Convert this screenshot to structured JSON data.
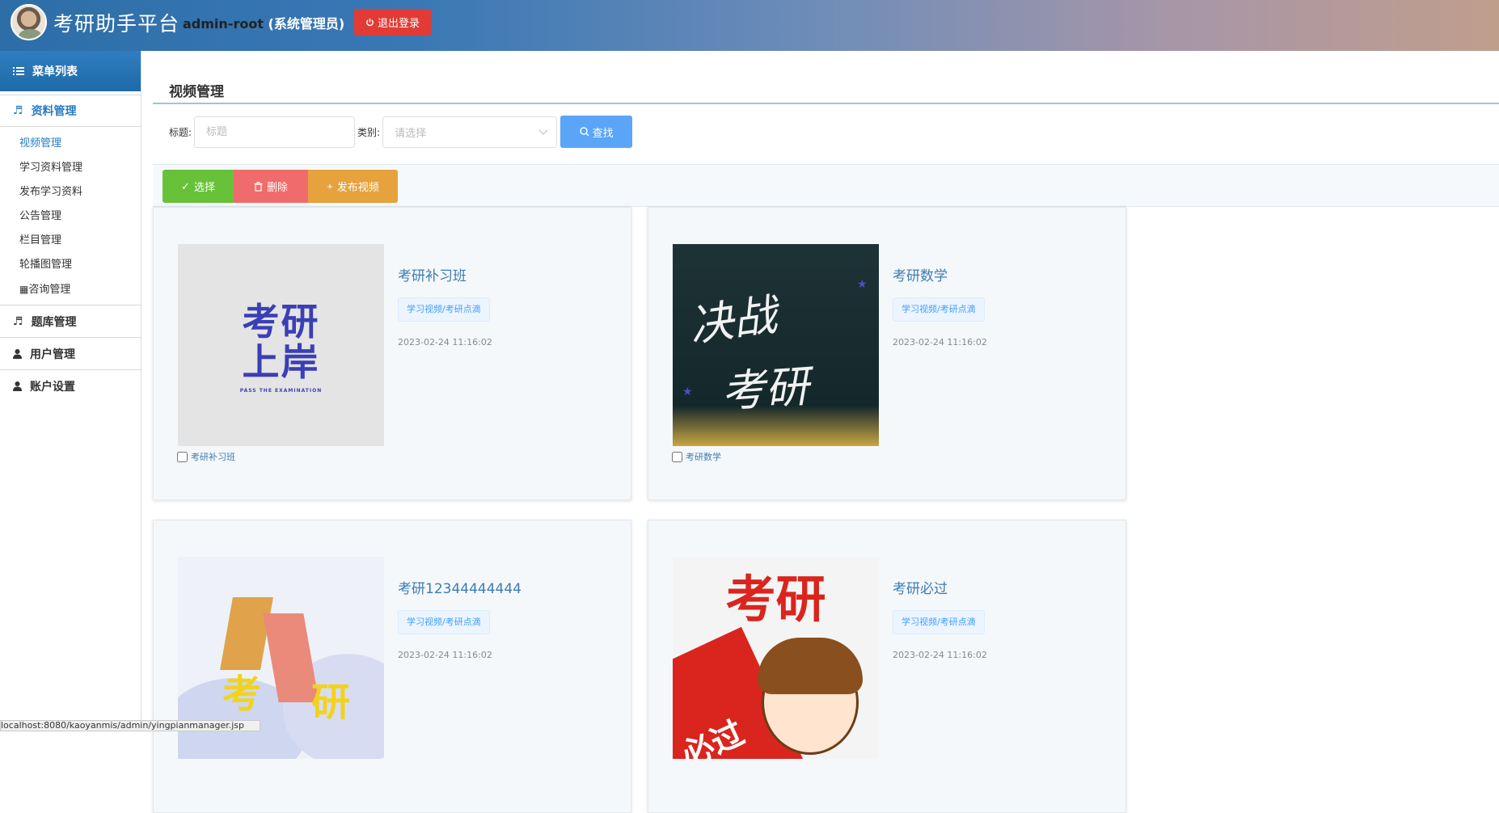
{
  "header": {
    "site_title": "考研助手平台",
    "username": "admin-root",
    "role": "(系统管理员)",
    "logout_label": "退出登录"
  },
  "sidebar": {
    "menu_title": "菜单列表",
    "sections": [
      {
        "label": "资料管理",
        "icon": "music-note-icon",
        "active": true
      },
      {
        "label": "题库管理",
        "icon": "music-note-icon"
      },
      {
        "label": "用户管理",
        "icon": "user-icon"
      },
      {
        "label": "账户设置",
        "icon": "user-icon"
      }
    ],
    "sub_items": [
      {
        "label": "视频管理",
        "active": true
      },
      {
        "label": "学习资料管理"
      },
      {
        "label": "发布学习资料"
      },
      {
        "label": "公告管理"
      },
      {
        "label": "栏目管理"
      },
      {
        "label": "轮播图管理"
      },
      {
        "label": "咨询管理",
        "icon": "calendar-icon"
      }
    ]
  },
  "main": {
    "page_title": "视频管理",
    "search": {
      "title_label": "标题:",
      "title_placeholder": "标题",
      "category_label": "类别:",
      "category_placeholder": "请选择",
      "search_button": "查找"
    },
    "toolbar": {
      "select_label": "选择",
      "delete_label": "删除",
      "publish_label": "发布视频"
    },
    "cards": [
      {
        "title": "考研补习班",
        "tag": "学习视频/考研点滴",
        "date": "2023-02-24 11:16:02",
        "checkbox_label": "考研补习班",
        "thumb_text_1": "考研",
        "thumb_text_2": "上岸",
        "thumb_subtext": "PASS THE EXAMINATION"
      },
      {
        "title": "考研数学",
        "tag": "学习视频/考研点滴",
        "date": "2023-02-24 11:16:02",
        "checkbox_label": "考研数学",
        "thumb_text_1": "决战",
        "thumb_text_2": "考研"
      },
      {
        "title": "考研12344444444",
        "tag": "学习视频/考研点滴",
        "date": "2023-02-24 11:16:02",
        "thumb_text_1": "考",
        "thumb_text_2": "研"
      },
      {
        "title": "考研必过",
        "tag": "学习视频/考研点滴",
        "date": "2023-02-24 11:16:02",
        "thumb_text_1": "考研",
        "thumb_text_2": "必过"
      }
    ]
  },
  "status_bar": "localhost:8080/kaoyanmis/admin/yingpianmanager.jsp",
  "colors": {
    "accent": "#2a7dc0",
    "logout": "#e23b35",
    "select_btn": "#67c23a",
    "delete_btn": "#f06b6b",
    "publish_btn": "#e6a23c",
    "search_btn": "#5aa5f7"
  }
}
